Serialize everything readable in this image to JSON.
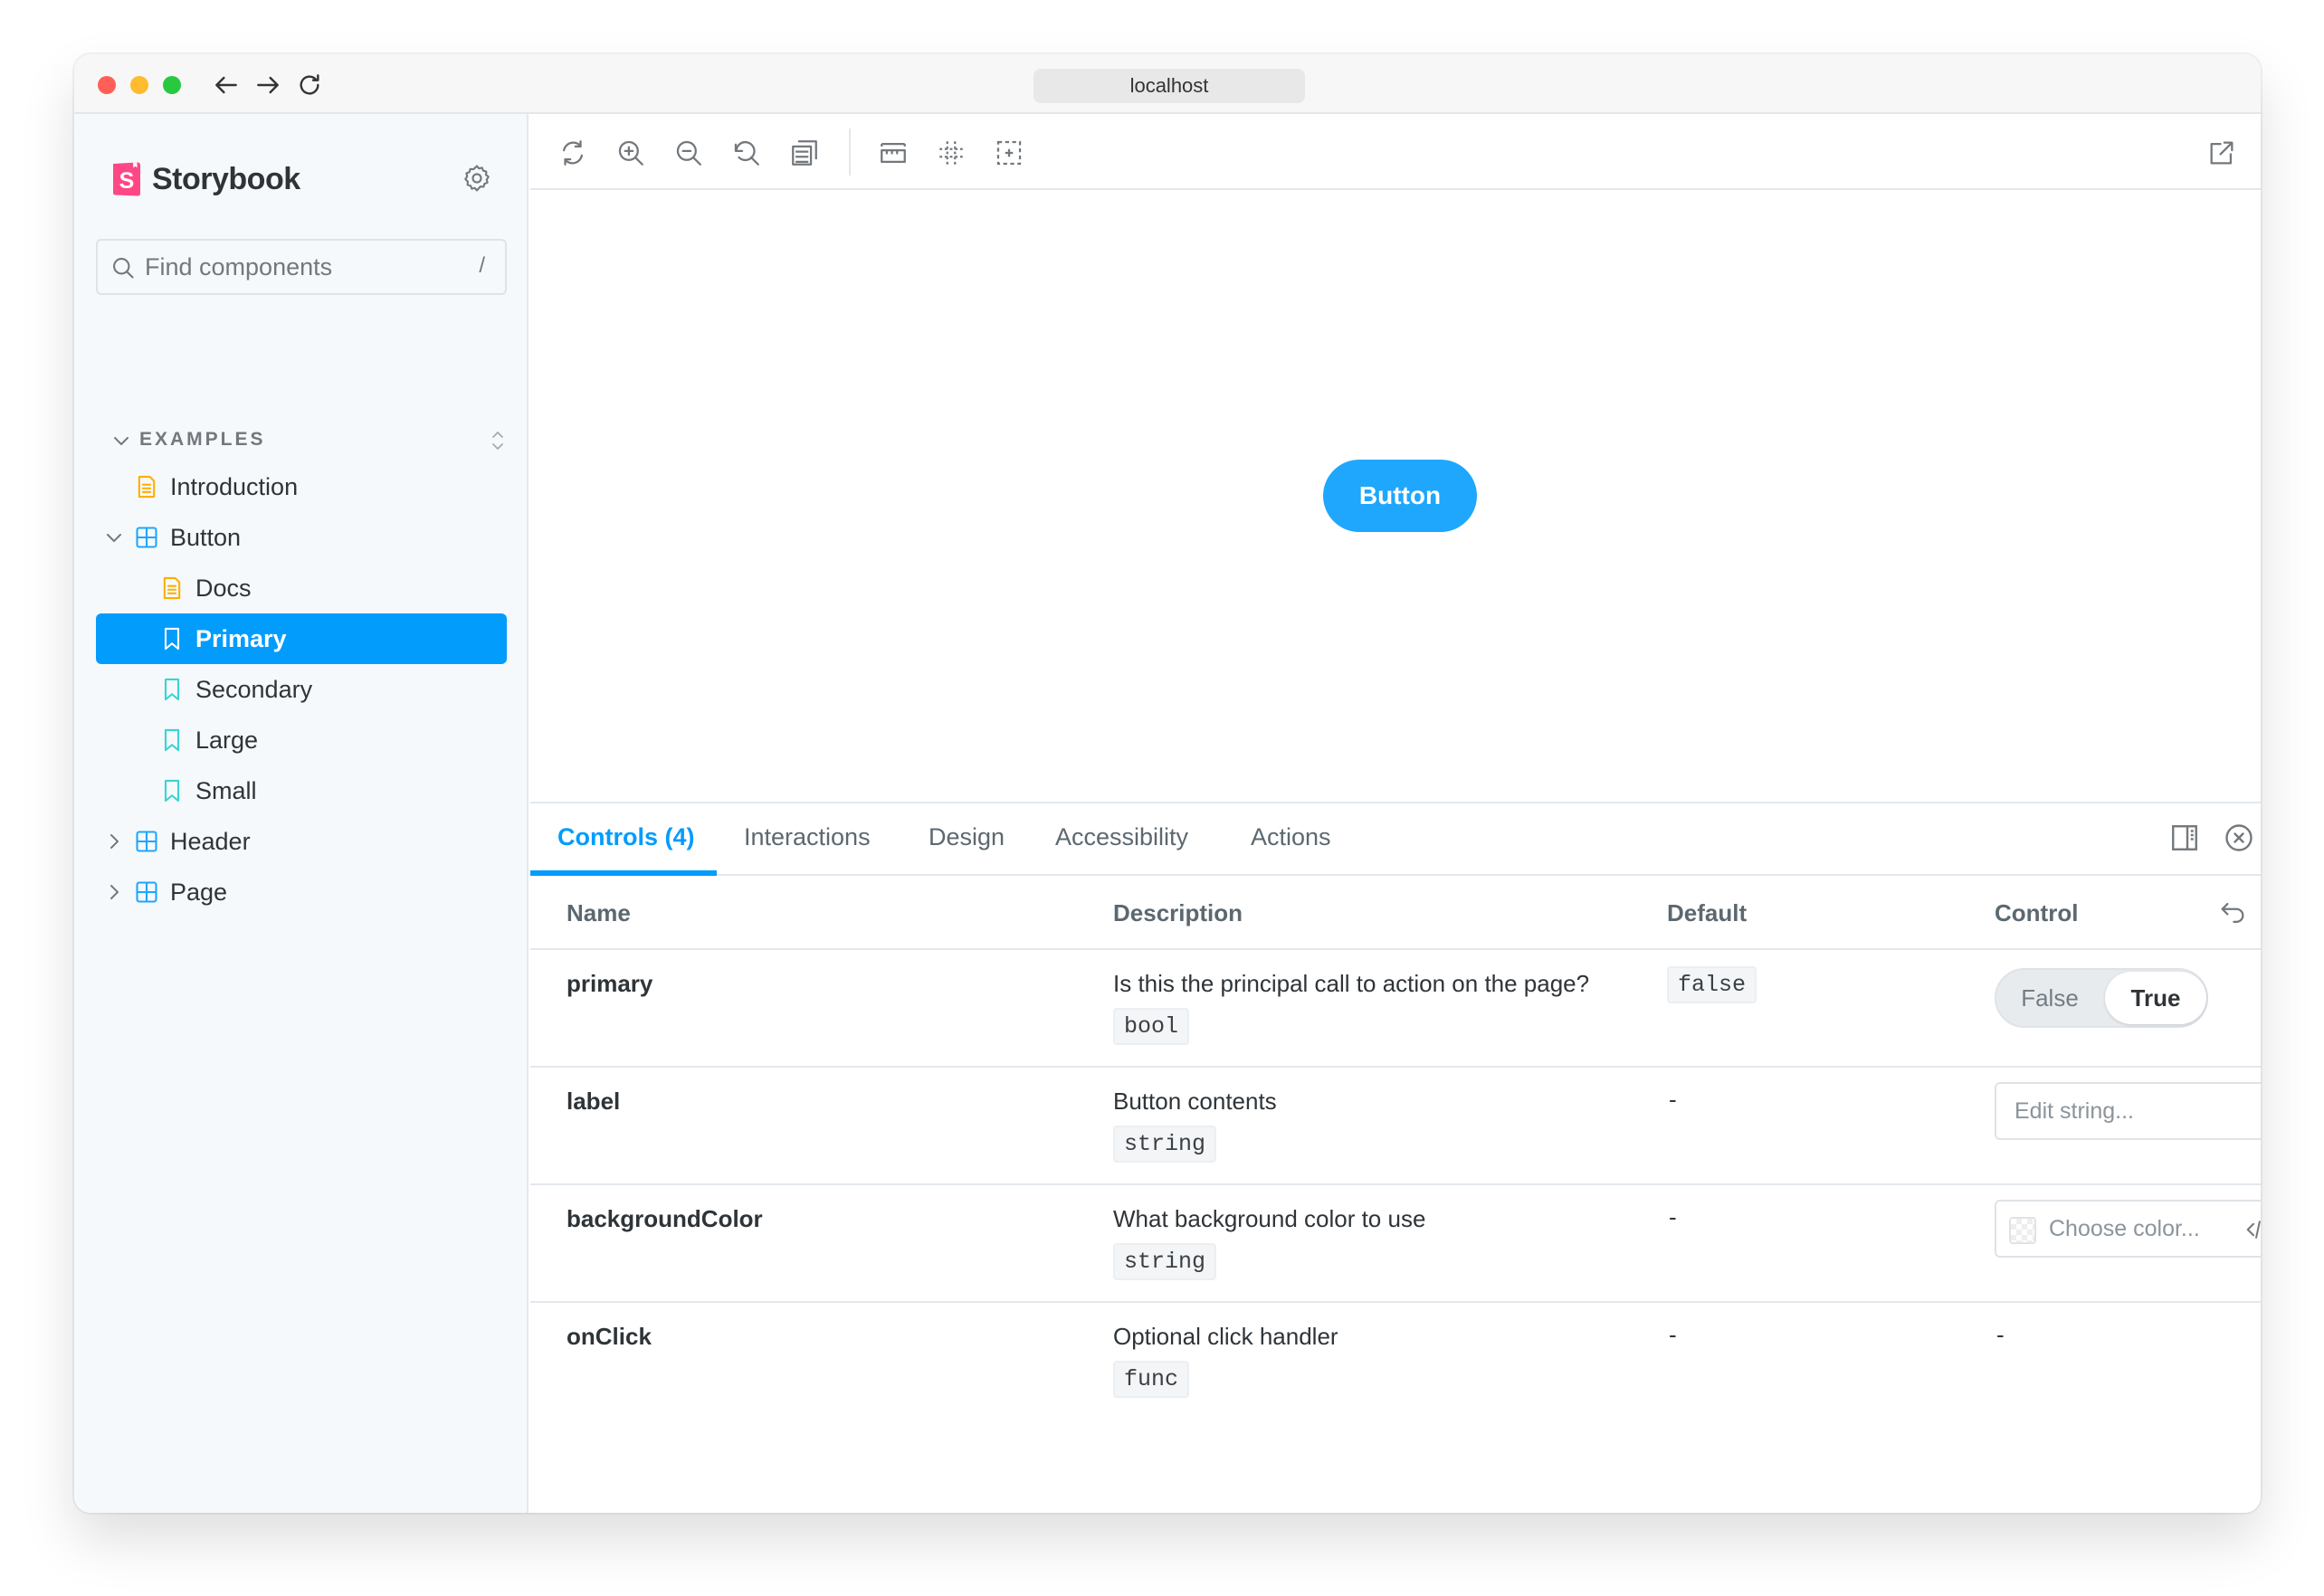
{
  "browser": {
    "url": "localhost"
  },
  "sidebar": {
    "brand": "Storybook",
    "search": {
      "placeholder": "Find components",
      "shortcut": "/"
    },
    "section": "EXAMPLES",
    "items": [
      {
        "label": "Introduction",
        "type": "docs"
      },
      {
        "label": "Button",
        "type": "component",
        "expanded": true
      },
      {
        "label": "Docs",
        "type": "docs"
      },
      {
        "label": "Primary",
        "type": "story",
        "selected": true
      },
      {
        "label": "Secondary",
        "type": "story"
      },
      {
        "label": "Large",
        "type": "story"
      },
      {
        "label": "Small",
        "type": "story"
      },
      {
        "label": "Header",
        "type": "component",
        "expanded": false
      },
      {
        "label": "Page",
        "type": "component",
        "expanded": false
      }
    ]
  },
  "preview": {
    "button_label": "Button"
  },
  "panel": {
    "tabs": [
      "Controls (4)",
      "Interactions",
      "Design",
      "Accessibility",
      "Actions"
    ],
    "active_tab": "Controls (4)",
    "columns": [
      "Name",
      "Description",
      "Default",
      "Control"
    ],
    "rows": [
      {
        "name": "primary",
        "description": "Is this the principal call to action on the page?",
        "type": "bool",
        "default": "false",
        "control": "toggle"
      },
      {
        "name": "label",
        "description": "Button contents",
        "type": "string",
        "default": "-",
        "control": "text"
      },
      {
        "name": "backgroundColor",
        "description": "What background color to use",
        "type": "string",
        "default": "-",
        "control": "color"
      },
      {
        "name": "onClick",
        "description": "Optional click handler",
        "type": "func",
        "default": "-",
        "control": "-"
      }
    ],
    "toggle": {
      "false_label": "False",
      "true_label": "True",
      "value": true
    },
    "text_placeholder": "Edit string...",
    "color_placeholder": "Choose color..."
  },
  "colors": {
    "accent": "#029cfd",
    "button": "#1ea7fd",
    "sidebar_bg": "#f6f9fc",
    "docs_icon": "#ffae00",
    "component_icon": "#1ea7fd",
    "story_icon": "#37d5d3"
  }
}
